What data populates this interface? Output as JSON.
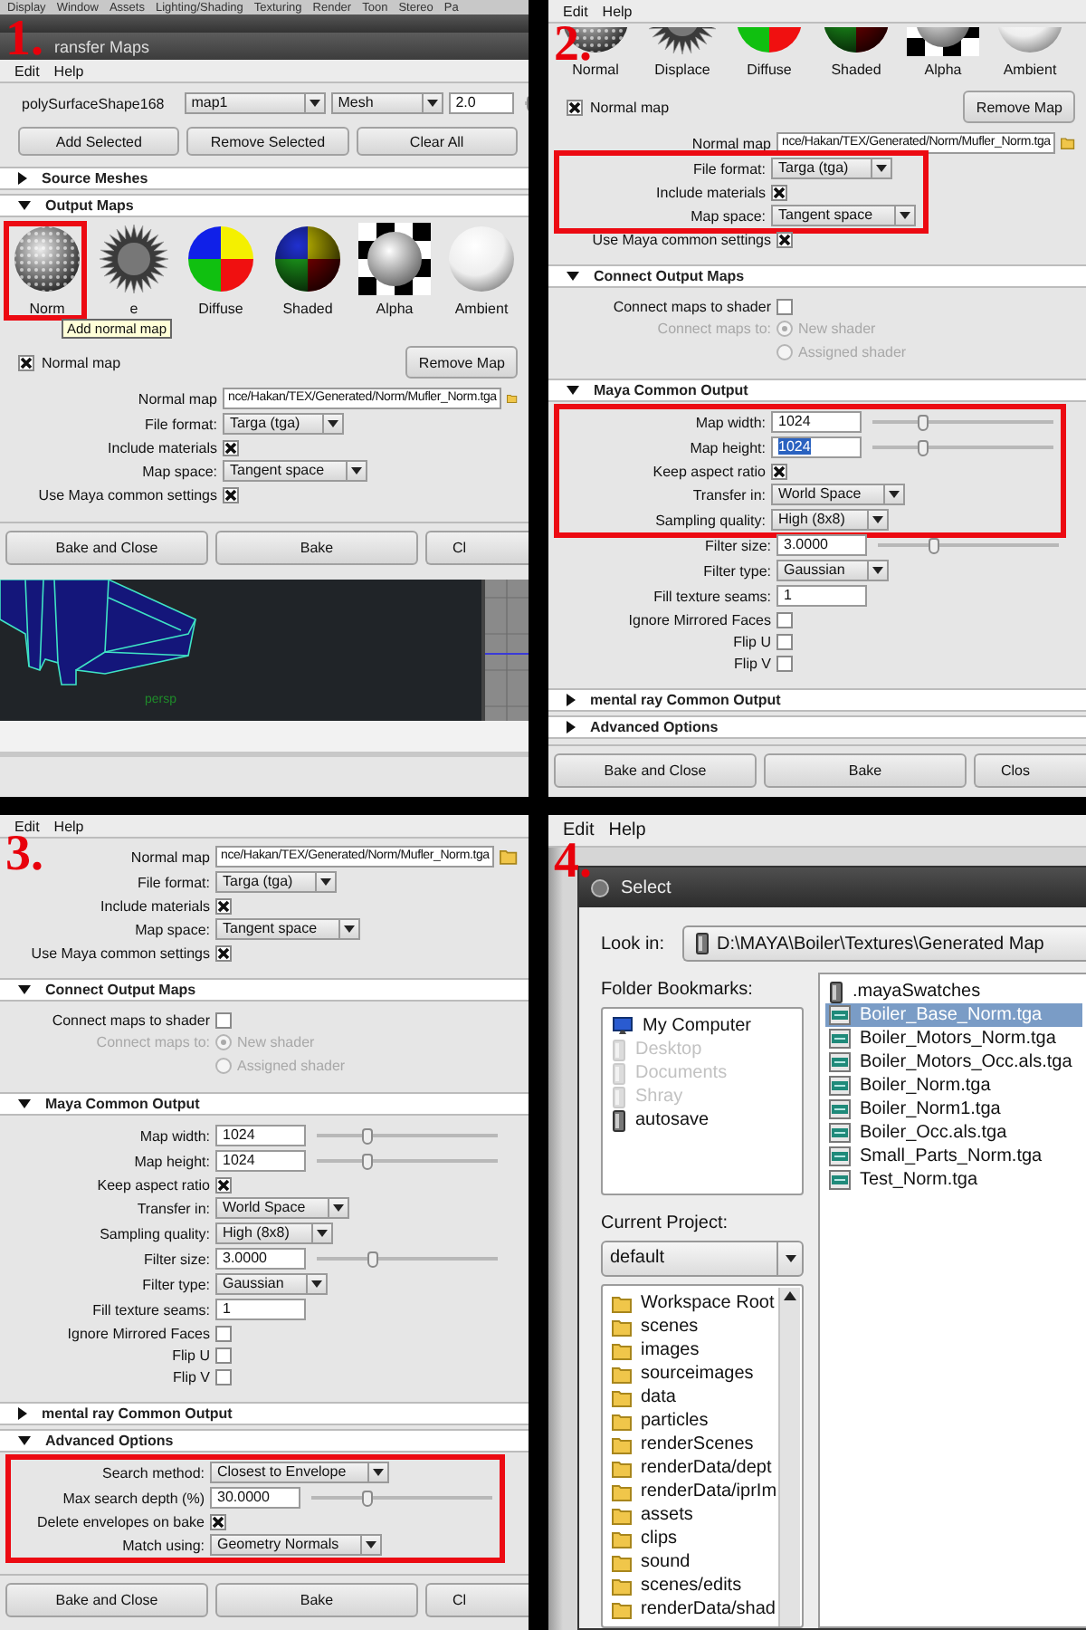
{
  "panels": [
    {
      "kind": "maya_dialog",
      "number": "1.",
      "blocks": [
        {
          "kind": "appbar",
          "items": [
            "Display",
            "Window",
            "Assets",
            "Lighting/Shading",
            "Texturing",
            "Render",
            "Toon",
            "Stereo",
            "Pa"
          ]
        },
        {
          "kind": "titlebar",
          "title": "ransfer Maps"
        },
        {
          "kind": "menubar",
          "items": [
            "Edit",
            "Help"
          ]
        },
        {
          "kind": "meshrow",
          "name": "polySurfaceShape168",
          "uv_set": "map1",
          "mesh_type": "Mesh",
          "value": "2.0",
          "level": 0.05
        },
        {
          "kind": "buttonrow",
          "buttons": [
            "Add Selected",
            "Remove Selected",
            "Clear All"
          ]
        },
        {
          "kind": "section",
          "title": "Source Meshes",
          "expanded": false
        },
        {
          "kind": "section",
          "title": "Output Maps",
          "expanded": true
        },
        {
          "kind": "tiles",
          "cropped": false,
          "tooltip": "Add normal map",
          "items": [
            {
              "kind": "normal",
              "label": "Norm",
              "highlight": true
            },
            {
              "kind": "displace",
              "label": "e",
              "highlight": false
            },
            {
              "kind": "diffuse",
              "label": "Diffuse",
              "highlight": false
            },
            {
              "kind": "shaded",
              "label": "Shaded",
              "highlight": false
            },
            {
              "kind": "alpha",
              "label": "Alpha",
              "highlight": false
            },
            {
              "kind": "ambient",
              "label": "Ambient",
              "highlight": false
            }
          ]
        },
        {
          "kind": "form",
          "rows": [
            {
              "kind": "map_toggle",
              "label": "Normal map",
              "checked": true,
              "button": "Remove Map"
            },
            {
              "kind": "path",
              "label": "Normal map",
              "value": "nce/Hakan/TEX/Generated/Norm/Mufler_Norm.tga"
            },
            {
              "kind": "dropdown",
              "label": "File format:",
              "value": "Targa (tga)"
            },
            {
              "kind": "checkbox",
              "label": "Include materials",
              "checked": true
            },
            {
              "kind": "dropdown",
              "label": "Map space:",
              "value": "Tangent space"
            },
            {
              "kind": "checkbox",
              "label": "Use Maya common settings",
              "checked": true
            }
          ]
        },
        {
          "kind": "footer",
          "buttons": [
            "Bake and Close",
            "Bake",
            "Cl"
          ]
        },
        {
          "kind": "viewport",
          "label": "persp"
        }
      ]
    },
    {
      "kind": "maya_dialog",
      "number": "2.",
      "blocks": [
        {
          "kind": "menubar",
          "items": [
            "Edit",
            "Help"
          ]
        },
        {
          "kind": "tiles",
          "cropped": true,
          "items": [
            {
              "kind": "normal",
              "label": "Normal",
              "highlight": false
            },
            {
              "kind": "displace",
              "label": "Displace",
              "highlight": false
            },
            {
              "kind": "diffuse",
              "label": "Diffuse",
              "highlight": false
            },
            {
              "kind": "shaded",
              "label": "Shaded",
              "highlight": false
            },
            {
              "kind": "alpha",
              "label": "Alpha",
              "highlight": false
            },
            {
              "kind": "ambient",
              "label": "Ambient",
              "highlight": false
            }
          ]
        },
        {
          "kind": "form",
          "rows": [
            {
              "kind": "map_toggle",
              "label": "Normal map",
              "checked": true,
              "button": "Remove Map",
              "highlight": false
            },
            {
              "kind": "path",
              "label": "Normal map",
              "value": "nce/Hakan/TEX/Generated/Norm/Mufler_Norm.tga",
              "highlight": false
            },
            {
              "kind": "dropdown",
              "label": "File format:",
              "value": "Targa (tga)",
              "highlight": true
            },
            {
              "kind": "checkbox",
              "label": "Include materials",
              "checked": true,
              "highlight": true
            },
            {
              "kind": "dropdown",
              "label": "Map space:",
              "value": "Tangent space",
              "highlight": true
            },
            {
              "kind": "checkbox",
              "label": "Use Maya common settings",
              "checked": true,
              "highlight": false
            }
          ]
        },
        {
          "kind": "section",
          "title": "Connect Output Maps",
          "expanded": true
        },
        {
          "kind": "form",
          "rows": [
            {
              "kind": "checkbox",
              "label": "Connect maps to shader",
              "checked": false
            },
            {
              "kind": "radio",
              "label": "Connect maps to:",
              "option": "New shader",
              "selected": true,
              "disabled": true
            },
            {
              "kind": "radio",
              "option": "Assigned shader",
              "selected": false,
              "disabled": true
            }
          ]
        },
        {
          "kind": "section",
          "title": "Maya Common Output",
          "expanded": true
        },
        {
          "kind": "form",
          "rows": [
            {
              "kind": "number",
              "label": "Map width:",
              "value": "1024",
              "level": 0.27,
              "highlight": true
            },
            {
              "kind": "number",
              "label": "Map height:",
              "value": "1024",
              "level": 0.27,
              "selected": true,
              "highlight": true
            },
            {
              "kind": "checkbox",
              "label": "Keep aspect ratio",
              "checked": true,
              "highlight": true
            },
            {
              "kind": "dropdown",
              "label": "Transfer in:",
              "value": "World Space",
              "highlight": true
            },
            {
              "kind": "dropdown",
              "label": "Sampling quality:",
              "value": "High (8x8)",
              "highlight": true
            },
            {
              "kind": "number",
              "label": "Filter size:",
              "value": "3.0000",
              "level": 0.3,
              "highlight": false
            },
            {
              "kind": "dropdown",
              "label": "Filter type:",
              "value": "Gaussian",
              "highlight": false
            },
            {
              "kind": "number",
              "label": "Fill texture seams:",
              "value": "1",
              "highlight": false
            },
            {
              "kind": "checkbox",
              "label": "Ignore Mirrored Faces",
              "checked": false,
              "highlight": false
            },
            {
              "kind": "checkbox",
              "label": "Flip U",
              "checked": false,
              "highlight": false
            },
            {
              "kind": "checkbox",
              "label": "Flip V",
              "checked": false,
              "highlight": false
            }
          ]
        },
        {
          "kind": "section",
          "title": "mental ray Common Output",
          "expanded": false
        },
        {
          "kind": "section",
          "title": "Advanced Options",
          "expanded": false
        },
        {
          "kind": "footer",
          "buttons": [
            "Bake and Close",
            "Bake",
            "Clos"
          ]
        }
      ]
    },
    {
      "kind": "maya_dialog",
      "number": "3.",
      "blocks": [
        {
          "kind": "menubar",
          "items": [
            "Edit",
            "Help"
          ]
        },
        {
          "kind": "form",
          "rows": [
            {
              "kind": "path",
              "label": "Normal map",
              "value": "nce/Hakan/TEX/Generated/Norm/Mufler_Norm.tga"
            },
            {
              "kind": "dropdown",
              "label": "File format:",
              "value": "Targa (tga)"
            },
            {
              "kind": "checkbox",
              "label": "Include materials",
              "checked": true
            },
            {
              "kind": "dropdown",
              "label": "Map space:",
              "value": "Tangent space"
            },
            {
              "kind": "checkbox",
              "label": "Use Maya common settings",
              "checked": true
            }
          ]
        },
        {
          "kind": "section",
          "title": "Connect Output Maps",
          "expanded": true
        },
        {
          "kind": "form",
          "rows": [
            {
              "kind": "checkbox",
              "label": "Connect maps to shader",
              "checked": false
            },
            {
              "kind": "radio",
              "label": "Connect maps to:",
              "option": "New shader",
              "selected": true,
              "disabled": true
            },
            {
              "kind": "radio",
              "option": "Assigned shader",
              "selected": false,
              "disabled": true
            }
          ]
        },
        {
          "kind": "section",
          "title": "Maya Common Output",
          "expanded": true
        },
        {
          "kind": "form",
          "rows": [
            {
              "kind": "number",
              "label": "Map width:",
              "value": "1024",
              "level": 0.27
            },
            {
              "kind": "number",
              "label": "Map height:",
              "value": "1024",
              "level": 0.27,
              "selected": false
            },
            {
              "kind": "checkbox",
              "label": "Keep aspect ratio",
              "checked": true
            },
            {
              "kind": "dropdown",
              "label": "Transfer in:",
              "value": "World Space"
            },
            {
              "kind": "dropdown",
              "label": "Sampling quality:",
              "value": "High (8x8)"
            },
            {
              "kind": "number",
              "label": "Filter size:",
              "value": "3.0000",
              "level": 0.3
            },
            {
              "kind": "dropdown",
              "label": "Filter type:",
              "value": "Gaussian"
            },
            {
              "kind": "number",
              "label": "Fill texture seams:",
              "value": "1"
            },
            {
              "kind": "checkbox",
              "label": "Ignore Mirrored Faces",
              "checked": false
            },
            {
              "kind": "checkbox",
              "label": "Flip U",
              "checked": false
            },
            {
              "kind": "checkbox",
              "label": "Flip V",
              "checked": false
            }
          ]
        },
        {
          "kind": "section",
          "title": "mental ray Common Output",
          "expanded": false
        },
        {
          "kind": "section",
          "title": "Advanced Options",
          "expanded": true
        },
        {
          "kind": "form",
          "rows": [
            {
              "kind": "dropdown",
              "label": "Search method:",
              "value": "Closest to Envelope",
              "highlight": true
            },
            {
              "kind": "number",
              "label": "Max search depth (%)",
              "value": "30.0000",
              "level": 0.3,
              "highlight": true
            },
            {
              "kind": "checkbox",
              "label": "Delete envelopes on bake",
              "checked": true,
              "highlight": true
            },
            {
              "kind": "dropdown",
              "label": "Match using:",
              "value": "Geometry Normals",
              "highlight": true
            }
          ]
        },
        {
          "kind": "footer",
          "buttons": [
            "Bake and Close",
            "Bake",
            "Cl"
          ]
        }
      ]
    },
    {
      "kind": "file_dialog",
      "number": "4.",
      "blocks": [
        {
          "kind": "menubar",
          "items": [
            "Edit",
            "Help"
          ]
        },
        {
          "kind": "filedialog",
          "title": "Select",
          "look_in_label": "Look in:",
          "look_in": "D:\\MAYA\\Boiler\\Textures\\Generated Map",
          "bookmarks_label": "Folder Bookmarks:",
          "bookmarks": [
            {
              "kind": "computer",
              "label": "My Computer",
              "disabled": false
            },
            {
              "kind": "location",
              "label": "Desktop",
              "disabled": true
            },
            {
              "kind": "location",
              "label": "Documents",
              "disabled": true
            },
            {
              "kind": "location",
              "label": "Shray",
              "disabled": true
            },
            {
              "kind": "drive",
              "label": "autosave",
              "disabled": false
            }
          ],
          "project_label": "Current Project:",
          "project": "default",
          "folders": [
            "Workspace Root",
            "scenes",
            "images",
            "sourceimages",
            "data",
            "particles",
            "renderScenes",
            "renderData/dept",
            "renderData/iprIm",
            "assets",
            "clips",
            "sound",
            "scenes/edits",
            "renderData/shad"
          ],
          "files": [
            {
              "kind": "folder",
              "name": ".mayaSwatches",
              "selected": false
            },
            {
              "kind": "image",
              "name": "Boiler_Base_Norm.tga",
              "selected": true
            },
            {
              "kind": "image",
              "name": "Boiler_Motors_Norm.tga",
              "selected": false
            },
            {
              "kind": "image",
              "name": "Boiler_Motors_Occ.als.tga",
              "selected": false
            },
            {
              "kind": "image",
              "name": "Boiler_Norm.tga",
              "selected": false
            },
            {
              "kind": "image",
              "name": "Boiler_Norm1.tga",
              "selected": false
            },
            {
              "kind": "image",
              "name": "Boiler_Occ.als.tga",
              "selected": false
            },
            {
              "kind": "image",
              "name": "Small_Parts_Norm.tga",
              "selected": false
            },
            {
              "kind": "image",
              "name": "Test_Norm.tga",
              "selected": false
            }
          ]
        }
      ]
    }
  ]
}
